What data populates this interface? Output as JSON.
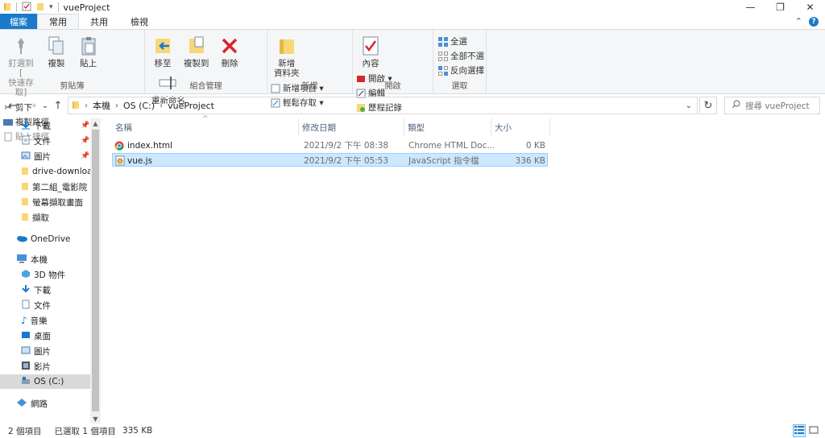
{
  "window": {
    "title": "vueProject",
    "minimize_glyph": "—",
    "maximize_glyph": "❐",
    "close_glyph": "✕"
  },
  "quick_access": {
    "dropdown_glyph": "▾"
  },
  "ribbon_tabs": {
    "file": "檔案",
    "home": "常用",
    "share": "共用",
    "view": "檢視",
    "collapse_glyph": "⌃",
    "help_glyph": "?"
  },
  "ribbon": {
    "clipboard": {
      "label": "剪貼簿",
      "pin": "釘選到 [\n快速存取]",
      "copy": "複製",
      "paste": "貼上",
      "cut": "剪下",
      "copy_path": "複製路徑",
      "paste_shortcut": "貼上捷徑"
    },
    "organize": {
      "label": "組合管理",
      "move_to": "移至",
      "copy_to": "複製到",
      "delete": "刪除",
      "rename": "重新命名"
    },
    "new": {
      "label": "新增",
      "new_folder": "新增\n資料夾",
      "new_item": "新增項目 ▾",
      "easy_access": "輕鬆存取 ▾"
    },
    "open": {
      "label": "開啟",
      "properties": "內容",
      "open": "開啟 ▾",
      "edit": "編輯",
      "history": "歷程記錄"
    },
    "select": {
      "label": "選取",
      "select_all": "全選",
      "select_none": "全部不選",
      "invert": "反向選擇"
    }
  },
  "address": {
    "back_glyph": "←",
    "forward_glyph": "→",
    "recent_glyph": "⌄",
    "up_glyph": "↑",
    "crumbs": [
      "本機",
      "OS (C:)",
      "vueProject"
    ],
    "crumb_sep": "›",
    "dropdown_glyph": "⌄",
    "refresh_glyph": "↻",
    "search_placeholder": "搜尋 vueProject"
  },
  "nav": {
    "pin_glyph": "📌",
    "quick": [
      {
        "label": "下載",
        "icon": "download-icon",
        "pinned": true
      },
      {
        "label": "文件",
        "icon": "document-icon",
        "pinned": true
      },
      {
        "label": "圖片",
        "icon": "picture-icon",
        "pinned": true
      },
      {
        "label": "drive-downloac",
        "icon": "folder-icon",
        "pinned": false
      },
      {
        "label": "第二組_電影院",
        "icon": "folder-icon",
        "pinned": false
      },
      {
        "label": "螢幕擷取畫面",
        "icon": "folder-icon",
        "pinned": false
      },
      {
        "label": "擷取",
        "icon": "folder-icon",
        "pinned": false
      }
    ],
    "onedrive": "OneDrive",
    "this_pc": "本機",
    "pc_items": [
      {
        "label": "3D 物件",
        "icon": "3d-objects-icon"
      },
      {
        "label": "下載",
        "icon": "download-icon"
      },
      {
        "label": "文件",
        "icon": "document-icon"
      },
      {
        "label": "音樂",
        "icon": "music-icon"
      },
      {
        "label": "桌面",
        "icon": "desktop-icon"
      },
      {
        "label": "圖片",
        "icon": "picture-icon"
      },
      {
        "label": "影片",
        "icon": "video-icon"
      },
      {
        "label": "OS (C:)",
        "icon": "drive-icon"
      }
    ],
    "network": "網路",
    "scroll_up_glyph": "▲",
    "scroll_down_glyph": "▼"
  },
  "columns": {
    "name": "名稱",
    "modified": "修改日期",
    "type": "類型",
    "size": "大小",
    "sort_glyph": "^"
  },
  "files": [
    {
      "name": "index.html",
      "modified": "2021/9/2 下午 08:38",
      "type": "Chrome HTML Doc...",
      "size": "0 KB",
      "icon": "chrome-html-icon",
      "selected": false
    },
    {
      "name": "vue.js",
      "modified": "2021/9/2 下午 05:53",
      "type": "JavaScript 指令檔",
      "size": "336 KB",
      "icon": "javascript-file-icon",
      "selected": true
    }
  ],
  "status": {
    "count": "2 個項目",
    "selection": "已選取 1 個項目",
    "selection_size": "335 KB"
  },
  "colors": {
    "accent": "#1979ca",
    "selection_bg": "#cce8ff",
    "selection_border": "#99d1ff",
    "folder": "#f8d775"
  }
}
